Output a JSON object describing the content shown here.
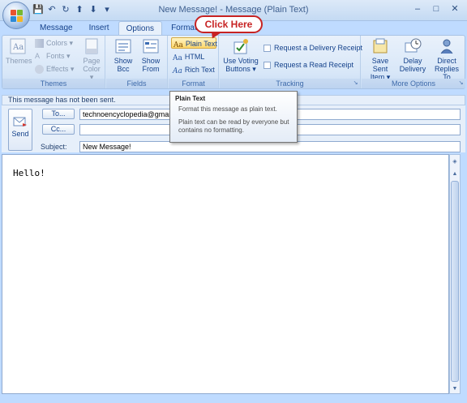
{
  "window": {
    "title": "New Message! - Message (Plain Text)",
    "controls": [
      "–",
      "□",
      "✕"
    ]
  },
  "qat": [
    "💾",
    "↶",
    "↻",
    "⬆",
    "⬇",
    "▾"
  ],
  "tabs": [
    "Message",
    "Insert",
    "Options",
    "Format Text"
  ],
  "active_tab": "Options",
  "ribbon": {
    "themes": {
      "themes_label": "Themes",
      "colors_label": "Colors ▾",
      "fonts_label": "Fonts ▾",
      "effects_label": "Effects ▾",
      "page_color_label": "Page Color ▾",
      "group_label": "Themes"
    },
    "fields": {
      "show_bcc_label": "Show Bcc",
      "show_from_label": "Show From",
      "group_label": "Fields"
    },
    "format": {
      "plain_text_label": "Plain Text",
      "html_label": "HTML",
      "rich_text_label": "Rich Text",
      "group_label": "Format"
    },
    "tracking": {
      "use_voting_label": "Use Voting Buttons ▾",
      "delivery_receipt_label": "Request a Delivery Receipt",
      "read_receipt_label": "Request a Read Receipt",
      "group_label": "Tracking"
    },
    "more_options": {
      "save_sent_label": "Save Sent Item ▾",
      "delay_delivery_label": "Delay Delivery",
      "direct_replies_label": "Direct Replies To",
      "group_label": "More Options"
    }
  },
  "callout": {
    "text": "Click Here"
  },
  "infobar": {
    "text": "This message has not been sent."
  },
  "header": {
    "send_label": "Send",
    "to_label": "To...",
    "to_value": "technoencyclopedia@gmail.com",
    "cc_label": "Cc...",
    "cc_value": "",
    "subject_label": "Subject:",
    "subject_value": "New Message!"
  },
  "tooltip": {
    "title": "Plain Text",
    "line1": "Format this message as plain text.",
    "line2": "Plain text can be read by everyone but contains no formatting."
  },
  "body": {
    "text": "Hello!"
  },
  "colors": {
    "accent": "#c72323",
    "ribbon_blue": "#15428b",
    "highlight": "#ffd86b"
  }
}
